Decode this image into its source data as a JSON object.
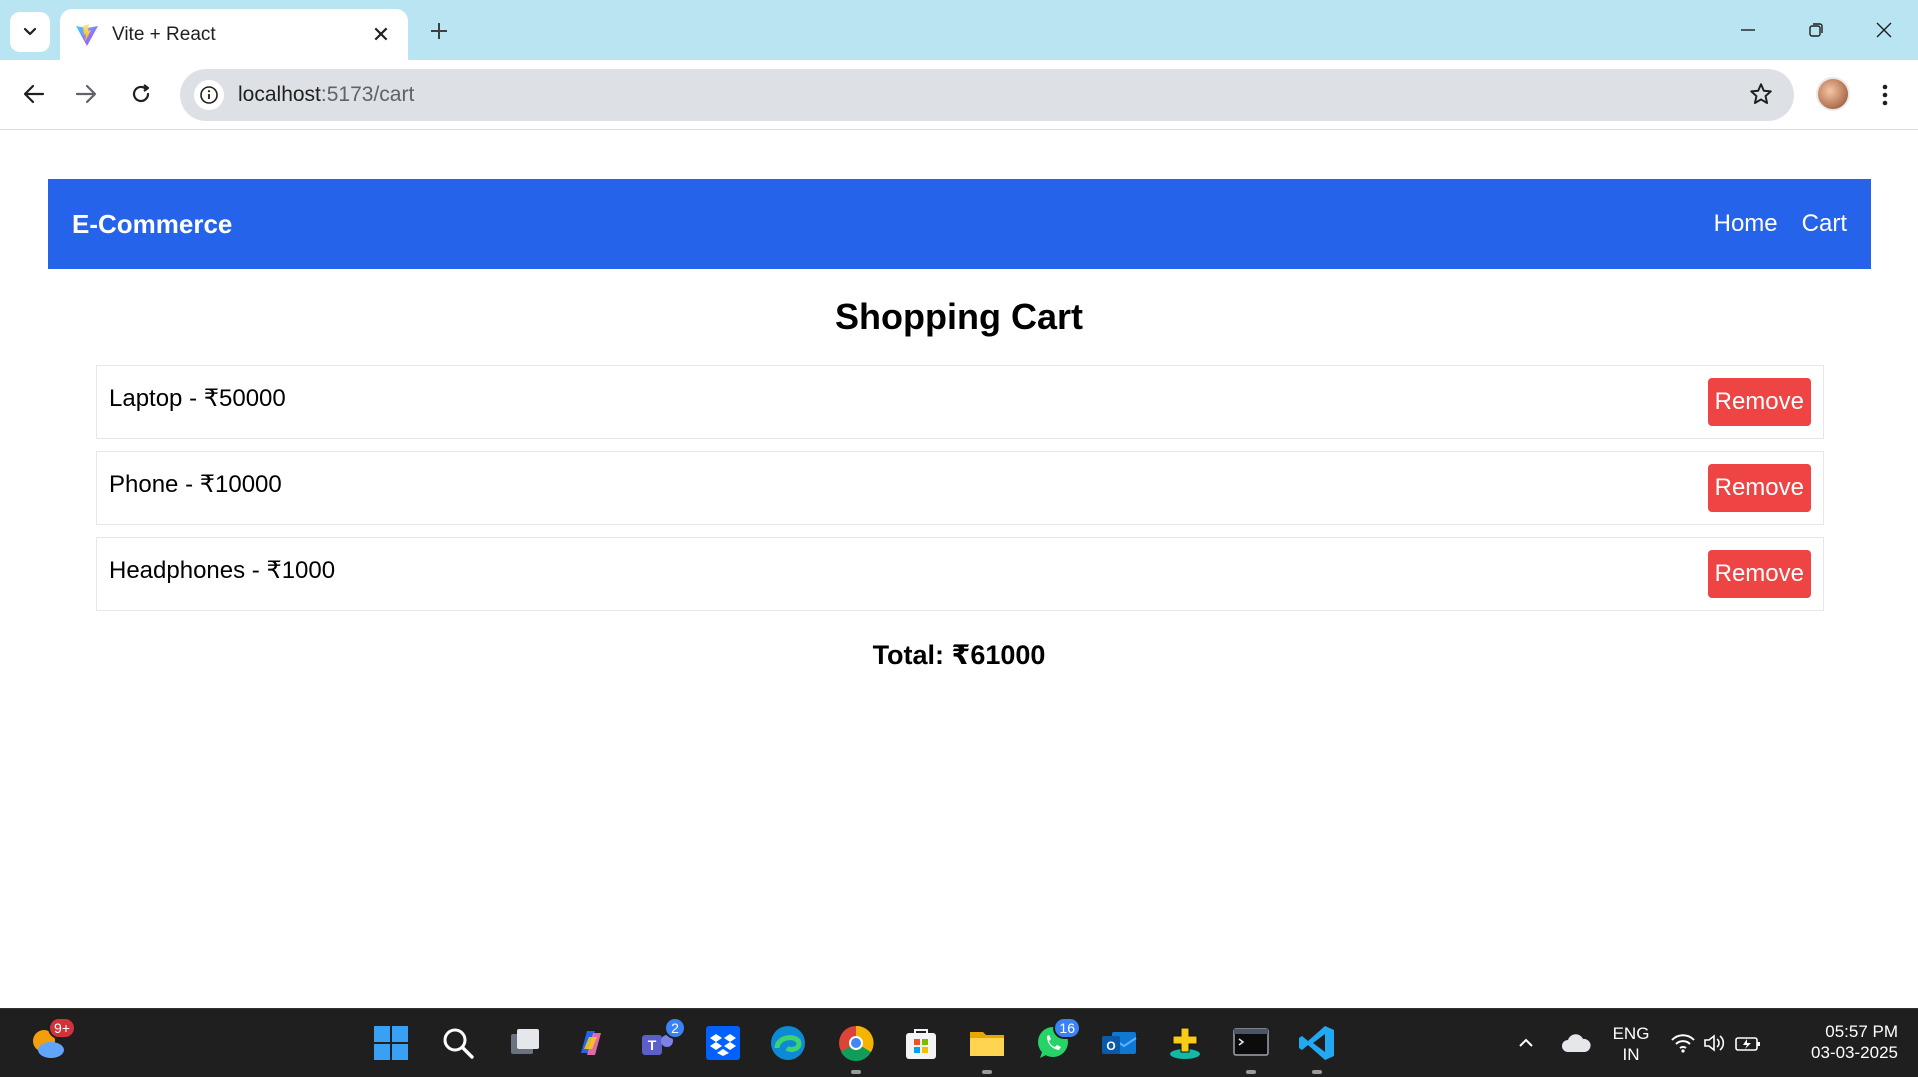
{
  "browser": {
    "tab_title": "Vite + React",
    "url_host": "localhost",
    "url_path": ":5173/cart",
    "tab_icon": "vite-logo-icon"
  },
  "navbar": {
    "brand": "E-Commerce",
    "links": [
      "Home",
      "Cart"
    ]
  },
  "cart": {
    "title": "Shopping Cart",
    "items": [
      {
        "label": "Laptop - ₹50000",
        "button": "Remove"
      },
      {
        "label": "Phone - ₹10000",
        "button": "Remove"
      },
      {
        "label": "Headphones - ₹1000",
        "button": "Remove"
      }
    ],
    "total": "Total: ₹61000"
  },
  "colors": {
    "navbar": "#2563eb",
    "remove_button": "#ef4444",
    "titlebar": "#b8e5f1"
  },
  "taskbar": {
    "weather_badge": "9+",
    "teams_badge": "2",
    "whatsapp_badge": "16",
    "language_top": "ENG",
    "language_bottom": "IN",
    "time": "05:57 PM",
    "date": "03-03-2025"
  }
}
